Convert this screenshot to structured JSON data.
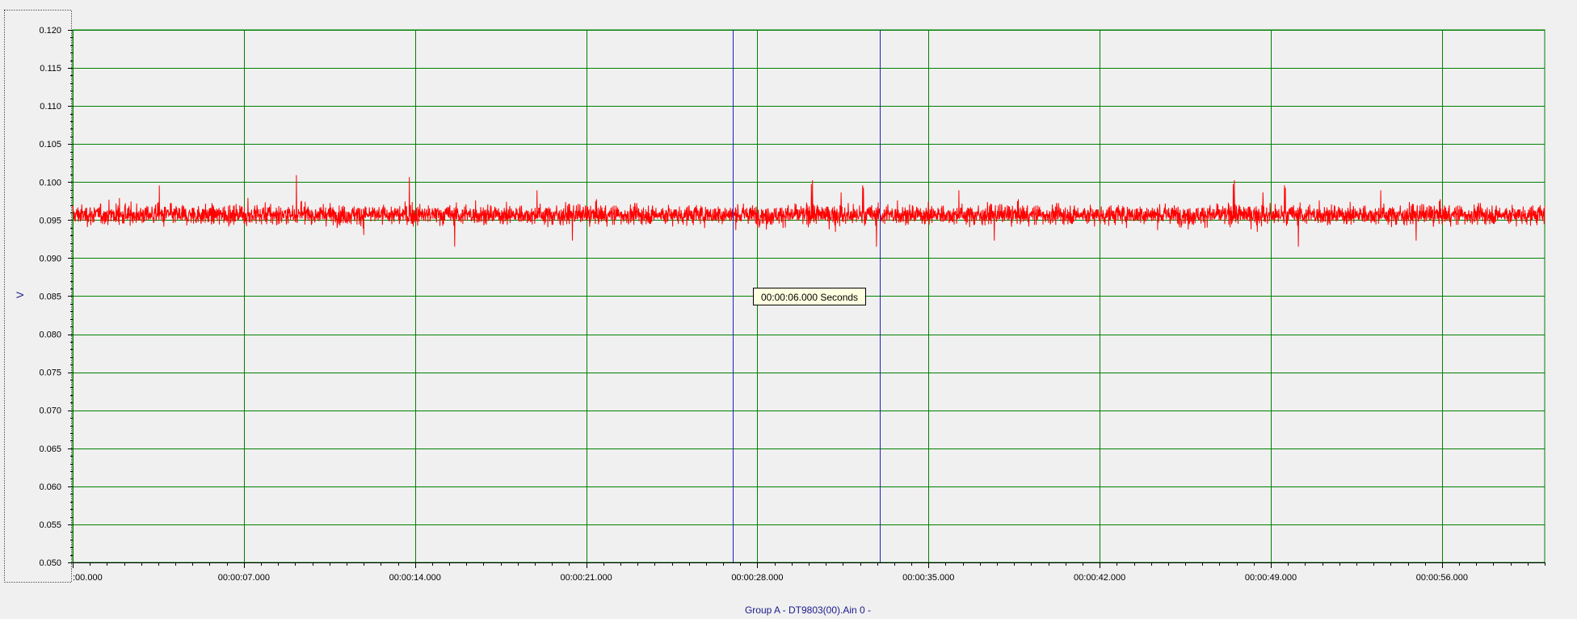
{
  "chart_data": {
    "type": "line",
    "title": "",
    "xlabel": "Group A - DT9803(00).Ain 0 -",
    "ylabel": "V",
    "xlim": [
      0,
      60.2
    ],
    "ylim": [
      0.05,
      0.12
    ],
    "grid": true,
    "yticks": [
      0.12,
      0.115,
      0.11,
      0.105,
      0.1,
      0.095,
      0.09,
      0.085,
      0.08,
      0.075,
      0.07,
      0.065,
      0.06,
      0.055,
      0.05
    ],
    "ytick_labels": [
      "0.120",
      "0.115",
      "0.110",
      "0.105",
      "0.100",
      "0.095",
      "0.090",
      "0.085",
      "0.080",
      "0.075",
      "0.070",
      "0.065",
      "0.060",
      "0.055",
      "0.050"
    ],
    "xticks": [
      0,
      7,
      14,
      21,
      28,
      35,
      42,
      49,
      56
    ],
    "xtick_labels": [
      ":00.000",
      "00:00:07.000",
      "00:00:14.000",
      "00:00:21.000",
      "00:00:28.000",
      "00:00:35.000",
      "00:00:42.000",
      "00:00:49.000",
      "00:00:56.000"
    ],
    "series": [
      {
        "color": "#ff0000",
        "baseline": 0.0957,
        "noise_band": [
          0.0925,
          0.0985
        ],
        "peak_excursions": [
          0.0915,
          0.101
        ]
      }
    ],
    "cursors": [
      {
        "x": 27.0,
        "color": "#2020c0"
      },
      {
        "x": 33.0,
        "color": "#2020c0"
      }
    ],
    "cursor_readout": {
      "text": "00:00:06.000 Seconds"
    }
  },
  "colors": {
    "background": "#f0f0f0",
    "grid": "#008000",
    "series": "#ff0000",
    "cursor": "#2020c0",
    "axis_title": "#1a1a8c",
    "readout_bg": "#ffffe1"
  }
}
